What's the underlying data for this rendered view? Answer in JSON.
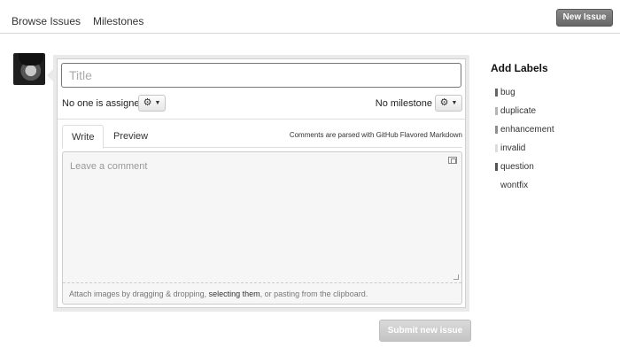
{
  "nav": {
    "browse_issues": "Browse Issues",
    "milestones": "Milestones",
    "new_issue_button": "New Issue"
  },
  "form": {
    "title_placeholder": "Title",
    "assignee_text": "No one is assigned",
    "milestone_text": "No milestone",
    "tabs": {
      "write": "Write",
      "preview": "Preview"
    },
    "markdown_note": "Comments are parsed with GitHub Flavored Markdown",
    "comment_placeholder": "Leave a comment",
    "attach": {
      "before": "Attach images by dragging & dropping, ",
      "link": "selecting them",
      "after": ", or pasting from the clipboard."
    },
    "submit_button": "Submit new issue"
  },
  "labels": {
    "heading": "Add Labels",
    "items": [
      {
        "name": "bug",
        "color": "#666666"
      },
      {
        "name": "duplicate",
        "color": "#b5b5b5"
      },
      {
        "name": "enhancement",
        "color": "#8e8e8e"
      },
      {
        "name": "invalid",
        "color": "#dcdcdc"
      },
      {
        "name": "question",
        "color": "#555555"
      },
      {
        "name": "wontfix",
        "color": "#ffffff"
      }
    ]
  }
}
